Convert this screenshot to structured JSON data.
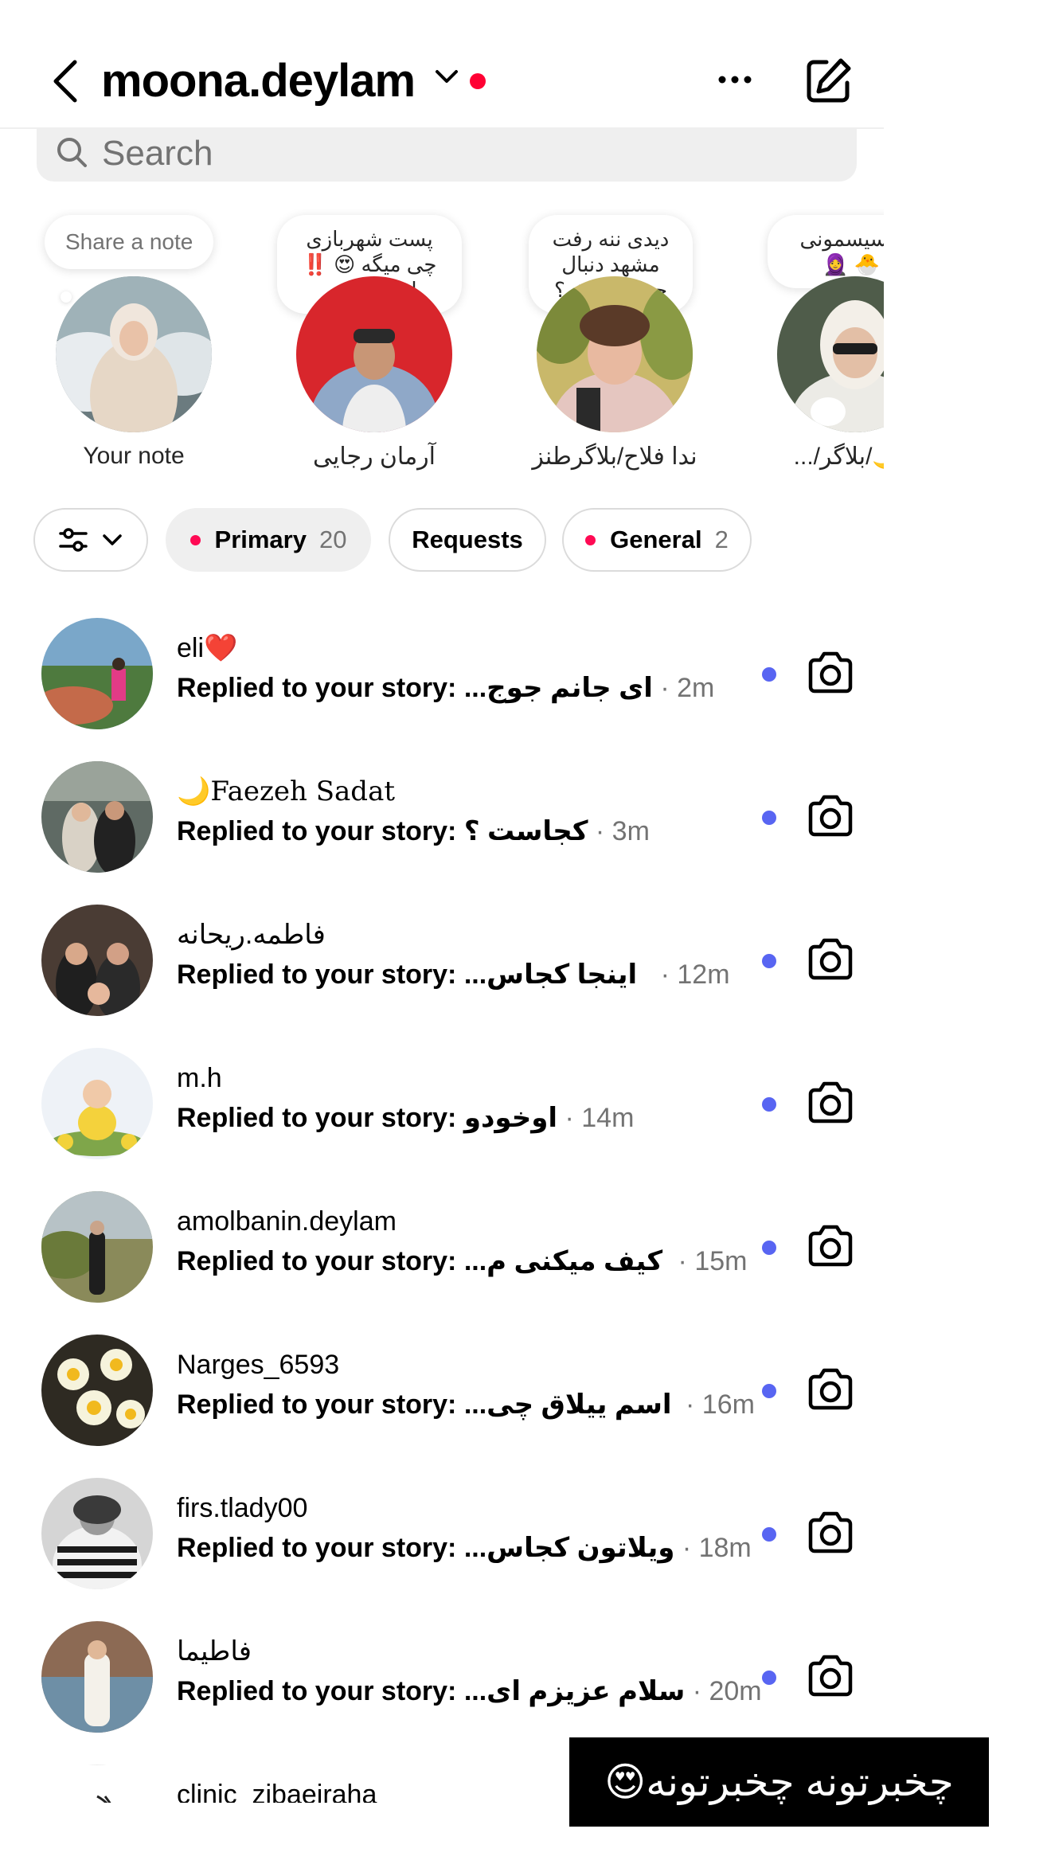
{
  "header": {
    "username": "moona.deylam",
    "colors": {
      "notification_dot": "#ff0033",
      "unread_dot": "#5865f2",
      "chip_dot": "#ff0a54"
    }
  },
  "search": {
    "placeholder": "Search"
  },
  "notes": [
    {
      "bubble": "Share a note",
      "label": "Your note",
      "avatar": "avatar-self"
    },
    {
      "bubble": "پست شهربازی\nچی میگه 😍 ‼️\nاولین بار....",
      "label": "آرمان رجایی",
      "avatar": "avatar-man-red"
    },
    {
      "bubble": "دیدی ننه رفت\nمشهد دنبال\nجواد و زنش؟",
      "label": "ندا فلاح/بلاگرطنز",
      "avatar": "avatar-woman-smile"
    },
    {
      "bubble": "د سیسمونی\n🐣 🧕",
      "label": "م🌙/بلاگر/...",
      "avatar": "avatar-woman-glasses"
    }
  ],
  "filters": {
    "settings_icon": "sliders-icon",
    "chips": [
      {
        "label": "Primary",
        "count": "20",
        "dot": true,
        "active": true
      },
      {
        "label": "Requests",
        "count": "",
        "dot": false,
        "active": false
      },
      {
        "label": "General",
        "count": "2",
        "dot": true,
        "active": false
      }
    ]
  },
  "threads": [
    {
      "name": "eli❤️",
      "prefix": "Replied to your story: ",
      "preview": "ای جانم جوج...",
      "time": " · 2m",
      "unread": true
    },
    {
      "name": "🌙Faezeh Sadat",
      "prefix": "Replied to your story: ",
      "preview": "کجاست ؟",
      "time": " · 3m",
      "unread": true
    },
    {
      "name": "فاطمه.ریحانه",
      "prefix": "Replied to your story: ",
      "preview": "اینجا کجاس...",
      "time": " · 12m",
      "unread": true
    },
    {
      "name": "m.h",
      "prefix": "Replied to your story: ",
      "preview": "اوخودو",
      "time": " · 14m",
      "unread": true
    },
    {
      "name": "amolbanin.deylam",
      "prefix": "Replied to your story: ",
      "preview": "کیف میکنی م...",
      "time": " · 15m",
      "unread": true
    },
    {
      "name": "Narges_6593",
      "prefix": "Replied to your story: ",
      "preview": "اسم ییلاق چی...",
      "time": " · 16m",
      "unread": true
    },
    {
      "name": "firs.tlady00",
      "prefix": "Replied to your story: ",
      "preview": "ویلاتون کجاس...",
      "time": " · 18m",
      "unread": true
    },
    {
      "name": "فاطیما",
      "prefix": "Replied to your story: ",
      "preview": "سلام عزیزم ای...",
      "time": " · 20m",
      "unread": true
    },
    {
      "name": "clinic_zibaeiraha",
      "prefix": "",
      "preview": "",
      "time": "",
      "unread": false
    }
  ],
  "caption": {
    "text": "چخبرتونه چخبرتونه😍"
  }
}
